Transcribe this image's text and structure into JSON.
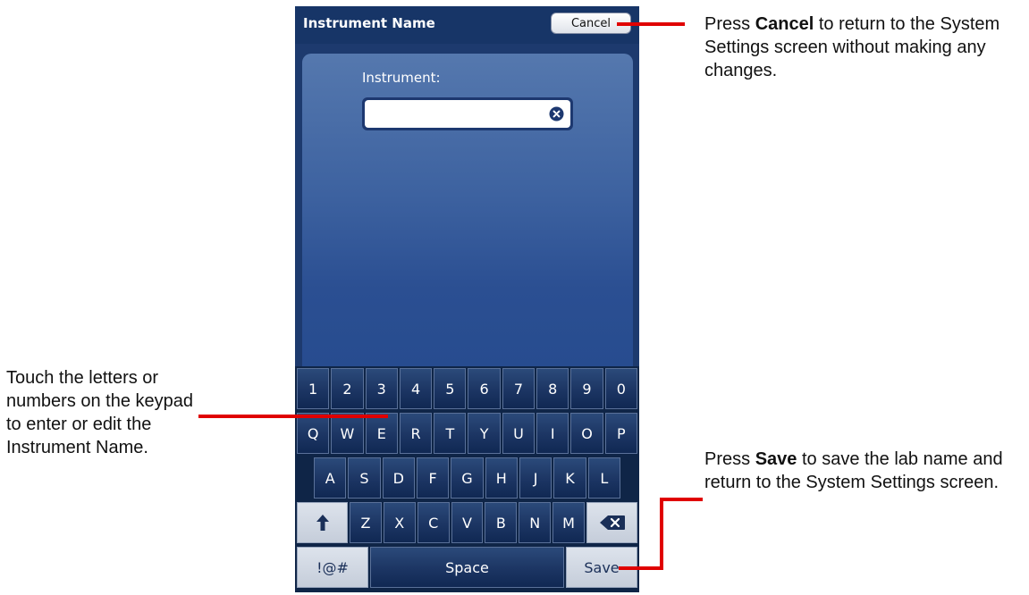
{
  "screen": {
    "title": "Instrument Name",
    "cancel_label": "Cancel",
    "field_label": "Instrument:",
    "field_value": "",
    "clear_icon": "clear-circle-icon"
  },
  "keyboard": {
    "numbers": [
      "1",
      "2",
      "3",
      "4",
      "5",
      "6",
      "7",
      "8",
      "9",
      "0"
    ],
    "row_q": [
      "Q",
      "W",
      "E",
      "R",
      "T",
      "Y",
      "U",
      "I",
      "O",
      "P"
    ],
    "row_a": [
      "A",
      "S",
      "D",
      "F",
      "G",
      "H",
      "J",
      "K",
      "L"
    ],
    "row_z": [
      "Z",
      "X",
      "C",
      "V",
      "B",
      "N",
      "M"
    ],
    "shift_icon": "shift-arrow-icon",
    "backspace_icon": "backspace-icon",
    "symbols_label": "!@#",
    "space_label": "Space",
    "save_label": "Save"
  },
  "annotations": {
    "cancel_note": {
      "prefix": "Press ",
      "bold": "Cancel",
      "suffix": " to return to the System Settings screen without making any changes."
    },
    "keypad_note": {
      "text": "Touch the letters or numbers on the keypad to enter or edit the Instrument Name."
    },
    "save_note": {
      "prefix": "Press ",
      "bold": "Save",
      "suffix": " to save the lab name and return to the System Settings screen."
    }
  },
  "colors": {
    "callout_line": "#e00000",
    "titlebar": "#173567",
    "content_gradient_top": "#5578ae"
  }
}
